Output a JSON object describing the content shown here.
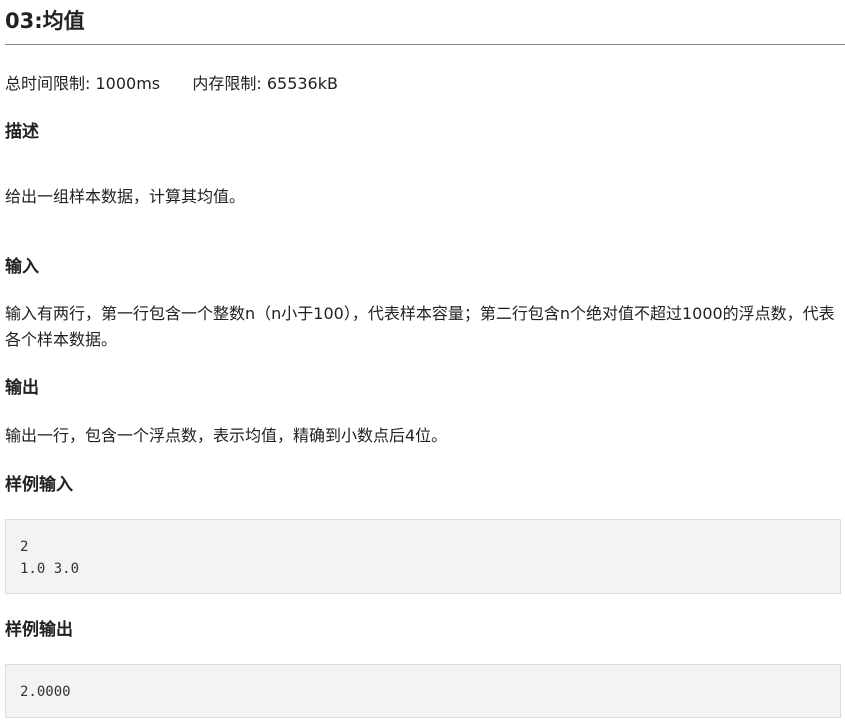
{
  "problem": {
    "title": "03:均值"
  },
  "limits": {
    "time_label": "总时间限制:",
    "time_value": "1000ms",
    "memory_label": "内存限制:",
    "memory_value": "65536kB"
  },
  "sections": {
    "description": {
      "heading": "描述",
      "text": "给出一组样本数据，计算其均值。"
    },
    "input": {
      "heading": "输入",
      "text": "输入有两行，第一行包含一个整数n（n小于100），代表样本容量；第二行包含n个绝对值不超过1000的浮点数，代表各个样本数据。"
    },
    "output": {
      "heading": "输出",
      "text": "输出一行，包含一个浮点数，表示均值，精确到小数点后4位。"
    },
    "sample_input": {
      "heading": "样例输入",
      "lines": [
        "2",
        "1.0 3.0"
      ]
    },
    "sample_output": {
      "heading": "样例输出",
      "lines": [
        "2.0000"
      ]
    }
  }
}
